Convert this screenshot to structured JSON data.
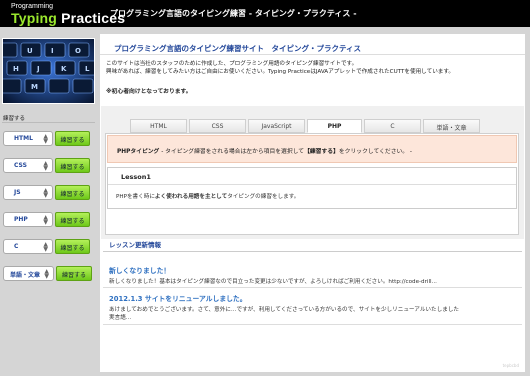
{
  "header": {
    "logo_small": "Programming",
    "logo_word1": "Typing",
    "logo_word2": "Practices",
    "title": "プログラミング言語のタイピング練習 - タイピング・プラクティス -"
  },
  "sidebar": {
    "label": "練習する",
    "button_label": "練習する",
    "rows": [
      {
        "value": "HTML"
      },
      {
        "value": "CSS"
      },
      {
        "value": "JS"
      },
      {
        "value": "PHP"
      },
      {
        "value": "C"
      },
      {
        "value": "単語・文章"
      }
    ]
  },
  "main": {
    "title": "プログラミング言語のタイピング練習サイト　タイピング・プラクティス",
    "intro_line1": "このサイトは当社のスタッフのために作成した、プログラミング用語のタイピング練習サイトです。",
    "intro_line2": "興味があれば、練習をしてみたい方はご自由にお使いください。Typing PracticeはJAVAアプレットで作成されたCUTTを使用しています。",
    "note": "※初心者向けとなっております。",
    "tabs": [
      "HTML",
      "CSS",
      "JavaScript",
      "PHP",
      "C",
      "単語・文章"
    ],
    "active_tab": "PHP",
    "notice_bold": "PHPタイピング",
    "notice_text1": "- タイピング練習をされる場合は左から項目を選択して",
    "notice_bold2": "【練習する】",
    "notice_text2": "をクリックしてください。 -",
    "lesson_title": "Lesson1",
    "lesson_text1": "PHPを書く時に",
    "lesson_bold": "よく使われる用語を主として",
    "lesson_text2": "タイピングの練習をします。"
  },
  "news": {
    "title": "レッスン更新情報",
    "items": [
      {
        "heading": "新しくなりました！",
        "text": "新しくなりました！基本はタイピング練習なので目立った変更は少ないですが、よろしければご利用ください。http://code-drill..."
      },
      {
        "heading": "2012.1.3 サイトをリニューアルしました。",
        "text1": "あけましておめでとうございます。さて、意外に…ですが、利用してくださっている方がいるので、サイトを少しリニューアルいたしました",
        "text2": "実言語..."
      }
    ]
  },
  "footer": {
    "mark": "tepbcbd"
  }
}
